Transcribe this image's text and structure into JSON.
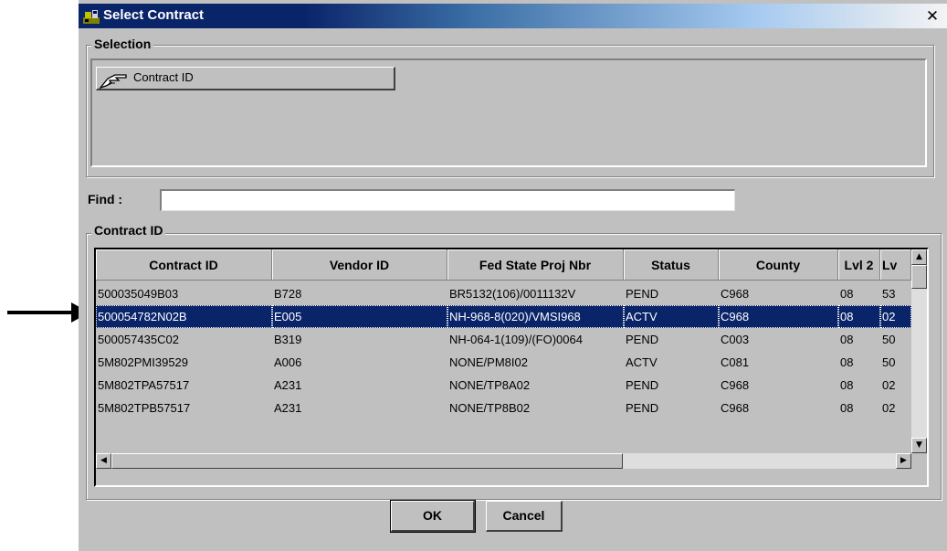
{
  "window": {
    "title": "Select Contract",
    "close_glyph": "✕"
  },
  "selection_group": {
    "label": "Selection",
    "button_label": "Contract ID",
    "button_icon": "pointing-hand-icon"
  },
  "find": {
    "label": "Find :",
    "value": "",
    "placeholder": ""
  },
  "results_group": {
    "label": "Contract ID"
  },
  "table": {
    "columns": [
      "Contract ID",
      "Vendor ID",
      "Fed State Proj Nbr",
      "Status",
      "County",
      "Lvl 2",
      "Lv"
    ],
    "rows": [
      [
        "500035049B03",
        "B728",
        "BR5132(106)/0011132V",
        "PEND",
        "C968",
        "08",
        "53"
      ],
      [
        "500054782N02B",
        "E005",
        "NH-968-8(020)/VMSI968",
        "ACTV",
        "C968",
        "08",
        "02"
      ],
      [
        "500057435C02",
        "B319",
        "NH-064-1(109)/(FO)0064",
        "PEND",
        "C003",
        "08",
        "50"
      ],
      [
        "5M802PMI39529",
        "A006",
        "NONE/PM8I02",
        "ACTV",
        "C081",
        "08",
        "50"
      ],
      [
        "5M802TPA57517",
        "A231",
        "NONE/TP8A02",
        "PEND",
        "C968",
        "08",
        "02"
      ],
      [
        "5M802TPB57517",
        "A231",
        "NONE/TP8B02",
        "PEND",
        "C968",
        "08",
        "02"
      ]
    ],
    "selected_row_index": 1
  },
  "buttons": {
    "ok": "OK",
    "cancel": "Cancel"
  },
  "icons": {
    "app": "app-icon",
    "close": "close-icon",
    "scroll_up": "▲",
    "scroll_down": "▼",
    "scroll_left": "◀",
    "scroll_right": "▶"
  },
  "colors": {
    "title_bar_start": "#0a246a",
    "selection_highlight": "#0a246a",
    "dialog_face": "#c0c0c0"
  }
}
